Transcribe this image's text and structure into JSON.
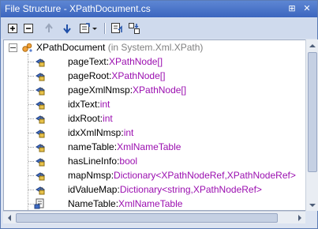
{
  "window": {
    "title": "File Structure - XPathDocument.cs",
    "pin_glyph": "⊞",
    "close_glyph": "✕"
  },
  "toolbar": {
    "buttons": [
      {
        "name": "expand-all-button",
        "icon": "expand-all-icon"
      },
      {
        "name": "collapse-all-button",
        "icon": "collapse-all-icon"
      },
      {
        "name": "move-up-button",
        "icon": "arrow-up-icon"
      },
      {
        "name": "move-down-button",
        "icon": "arrow-down-icon"
      },
      {
        "name": "group-dropdown-button",
        "icon": "group-menu-icon"
      },
      {
        "name": "track-caret-button",
        "icon": "track-caret-icon"
      },
      {
        "name": "sort-button",
        "icon": "sort-icon"
      }
    ]
  },
  "tree": {
    "root": {
      "name": "XPathDocument",
      "namespace": "(in System.Xml.XPath)",
      "icon": "class-icon"
    },
    "members": [
      {
        "name": "pageText",
        "type": "XPathNode[]",
        "icon": "private-field-icon"
      },
      {
        "name": "pageRoot",
        "type": "XPathNode[]",
        "icon": "private-field-icon"
      },
      {
        "name": "pageXmlNmsp",
        "type": "XPathNode[]",
        "icon": "private-field-icon"
      },
      {
        "name": "idxText",
        "type": "int",
        "icon": "private-field-icon"
      },
      {
        "name": "idxRoot",
        "type": "int",
        "icon": "private-field-icon"
      },
      {
        "name": "idxXmlNmsp",
        "type": "int",
        "icon": "private-field-icon"
      },
      {
        "name": "nameTable",
        "type": "XmlNameTable",
        "icon": "private-field-icon"
      },
      {
        "name": "hasLineInfo",
        "type": "bool",
        "icon": "private-field-icon"
      },
      {
        "name": "mapNmsp",
        "type": "Dictionary<XPathNodeRef,XPathNodeRef>",
        "icon": "private-field-icon"
      },
      {
        "name": "idValueMap",
        "type": "Dictionary<string,XPathNodeRef>",
        "icon": "private-field-icon"
      },
      {
        "name": "NameTable",
        "type": "XmlNameTable",
        "icon": "property-icon"
      }
    ]
  },
  "colors": {
    "title_bar": "#4a74c9",
    "type_text": "#9b0fb0",
    "namespace_text": "#808080"
  }
}
